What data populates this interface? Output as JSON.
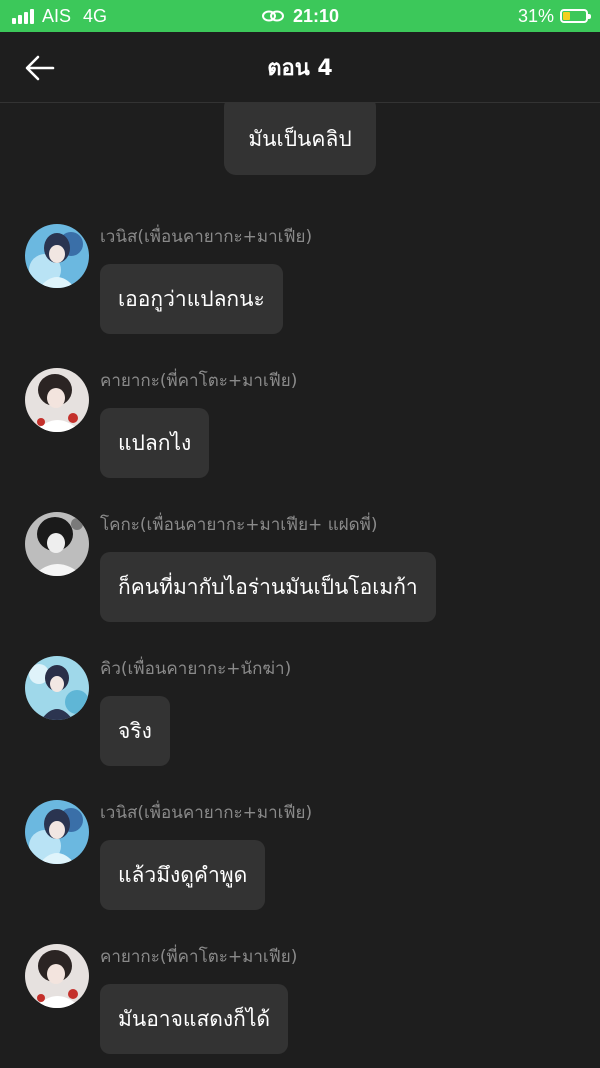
{
  "status_bar": {
    "carrier": "AIS",
    "network": "4G",
    "time": "21:10",
    "battery_percent": "31%",
    "battery_level": 0.31,
    "color": "#3cc85a"
  },
  "header": {
    "title": "ตอน 4",
    "back_icon": "arrow-left-icon"
  },
  "narration": "มันเป็นคลิป",
  "messages": [
    {
      "sender": "เวนิส(เพื่อนคายากะ+มาเฟีย)",
      "text": "เออกูว่าแปลกนะ"
    },
    {
      "sender": "คายากะ(พี่คาโตะ+มาเฟีย)",
      "text": "แปลกไง"
    },
    {
      "sender": "โคกะ(เพื่อนคายากะ+มาเฟีย+ แฝดพี่)",
      "text": "ก็คนที่มากับไอร่านมันเป็นโอเมก้า"
    },
    {
      "sender": "คิว(เพื่อนคายากะ+นักฆ่า)",
      "text": "จริง"
    },
    {
      "sender": "เวนิส(เพื่อนคายากะ+มาเฟีย)",
      "text": "แล้วมึงดูคำพูด"
    },
    {
      "sender": "คายากะ(พี่คาโตะ+มาเฟีย)",
      "text": "มันอาจแสดงก็ได้"
    }
  ],
  "colors": {
    "background": "#1e1e1e",
    "bubble": "#333333",
    "sender_text": "#8a8a8a"
  }
}
